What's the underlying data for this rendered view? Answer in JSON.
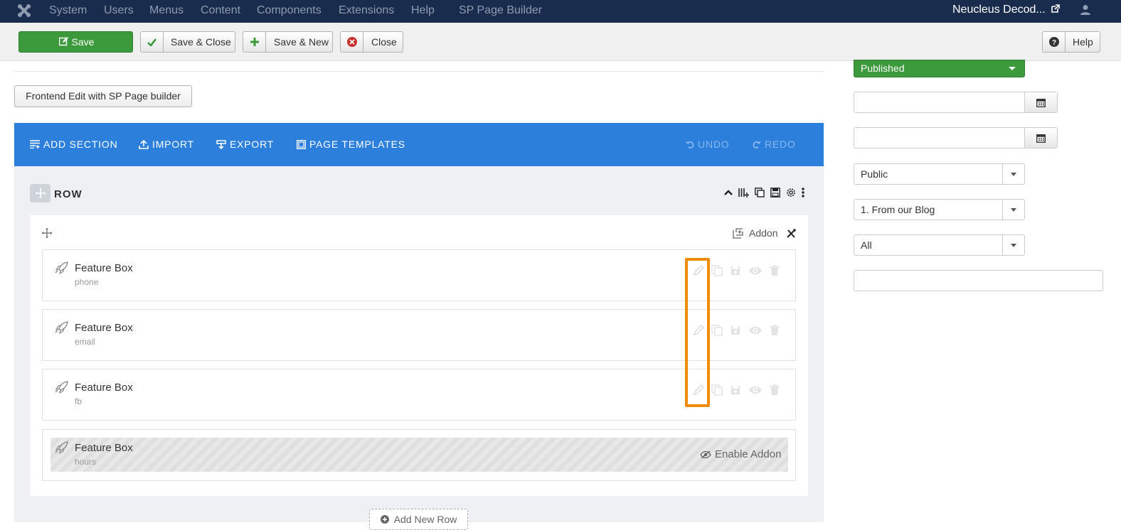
{
  "topnav": {
    "menu": [
      "System",
      "Users",
      "Menus",
      "Content",
      "Components",
      "Extensions",
      "Help",
      "SP Page Builder"
    ],
    "site_name": "Neucleus Decod..."
  },
  "toolbar": {
    "save": "Save",
    "save_close": "Save & Close",
    "save_new": "Save & New",
    "close": "Close",
    "help": "Help"
  },
  "frontend_edit": "Frontend Edit with SP Page builder",
  "builder": {
    "add_section": "ADD SECTION",
    "import": "IMPORT",
    "export": "EXPORT",
    "page_templates": "PAGE TEMPLATES",
    "undo": "UNDO",
    "redo": "REDO"
  },
  "row": {
    "title": "ROW",
    "addon_button": "Addon",
    "add_new_row": "Add New Row",
    "addons": [
      {
        "title": "Feature Box",
        "subtitle": "phone"
      },
      {
        "title": "Feature Box",
        "subtitle": "email"
      },
      {
        "title": "Feature Box",
        "subtitle": "fb"
      },
      {
        "title": "Feature Box",
        "subtitle": "hours",
        "disabled": true,
        "enable_label": "Enable Addon"
      }
    ]
  },
  "sidebar": {
    "status": "Published",
    "access": "Public",
    "category": "1. From our Blog",
    "language": "All"
  },
  "colors": {
    "nav_bg": "#1a2c4e",
    "builder_blue": "#2d7fdc",
    "success_green": "#3c9a3c",
    "highlight_orange": "#f08c0a"
  }
}
